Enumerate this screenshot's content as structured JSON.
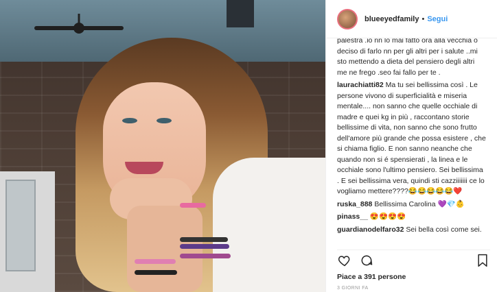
{
  "post": {
    "username": "blueeyedfamily",
    "separator": "•",
    "follow_label": "Segui"
  },
  "comments": [
    {
      "user": "",
      "text": "palestra .io nn lo mai fatto ora alla vecchia o deciso di farlo nn per gli altri per i salute ..mi sto mettendo a dieta del pensiero degli altri me ne frego .seo fai fallo per te ."
    },
    {
      "user": "laurachiatti82",
      "text": "Ma tu sei bellissima così . Le persone vivono di superficialità e miseria mentale.... non sanno che quelle occhiale di madre e quei kg in più , raccontano storie bellissime di vita, non sanno che sono frutto dell'amore più grande che possa esistere , che si chiama figlio. E non sanno neanche che quando non si é spensierati , la linea e le occhiale sono l'ultimo pensiero. Sei bellissima . E sei bellissima vera, quindi sti cazziiiiiii ce lo vogliamo mettere????😂😂😂😂😂❤️"
    },
    {
      "user": "ruska_888",
      "text": "Bellissima Carolina 💜💎👶"
    },
    {
      "user": "pinass__",
      "text": "😍😍😍😍"
    },
    {
      "user": "guardianodelfaro32",
      "text": "Sei bella così come sei."
    }
  ],
  "icons": {
    "like": "heart-icon",
    "comment": "comment-icon",
    "save": "bookmark-icon"
  },
  "likes_text": "Piace a 391 persone",
  "time_text": "3 GIORNI FA",
  "colors": {
    "link": "#3897f0",
    "text": "#262626",
    "muted": "#999999"
  }
}
